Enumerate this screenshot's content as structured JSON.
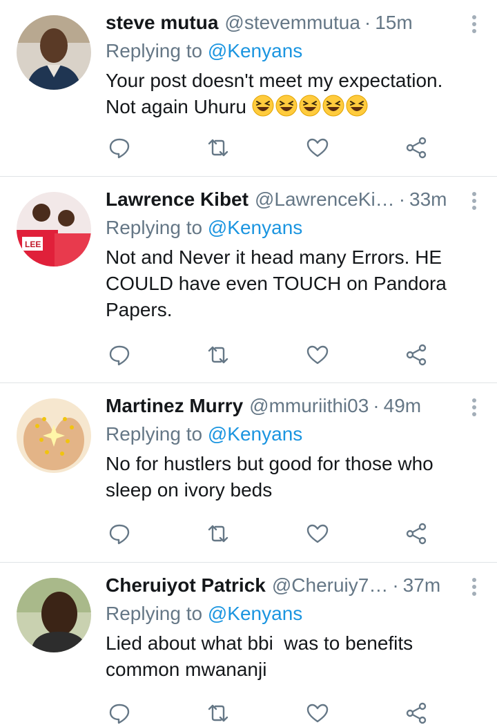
{
  "colors": {
    "text": "#14171a",
    "secondary": "#657786",
    "link": "#1b95e0",
    "divider": "#dfe3e6",
    "icon": "#657786"
  },
  "tweets": [
    {
      "name": "steve mutua",
      "handle": "@stevemmutua",
      "separator": "·",
      "time": "15m",
      "replying_prefix": "Replying to",
      "replying_mention": "@Kenyans",
      "text": "Your post doesn't meet my expectation.\nNot again Uhuru",
      "emoji": [
        "grinning-squinting-face",
        "grinning-squinting-face",
        "grinning-squinting-face",
        "grinning-squinting-face",
        "grinning-squinting-face"
      ]
    },
    {
      "name": "Lawrence Kibet",
      "handle": "@LawrenceKi…",
      "separator": "·",
      "time": "33m",
      "replying_prefix": "Replying to",
      "replying_mention": "@Kenyans",
      "text": "Not and Never it head many Errors. HE\nCOULD have even TOUCH on Pandora\nPapers."
    },
    {
      "name": "Martinez Murry",
      "handle": "@mmuriithi03",
      "separator": "·",
      "time": "49m",
      "replying_prefix": "Replying to",
      "replying_mention": "@Kenyans",
      "text": "No for hustlers but good for those who\nsleep on ivory beds"
    },
    {
      "name": "Cheruiyot Patrick",
      "handle": "@Cheruiy7…",
      "separator": "·",
      "time": "37m",
      "replying_prefix": "Replying to",
      "replying_mention": "@Kenyans",
      "text": "Lied about what bbi  was to benefits\ncommon mwananji"
    }
  ],
  "action_icons": [
    "reply-icon",
    "retweet-icon",
    "like-icon",
    "share-icon"
  ]
}
